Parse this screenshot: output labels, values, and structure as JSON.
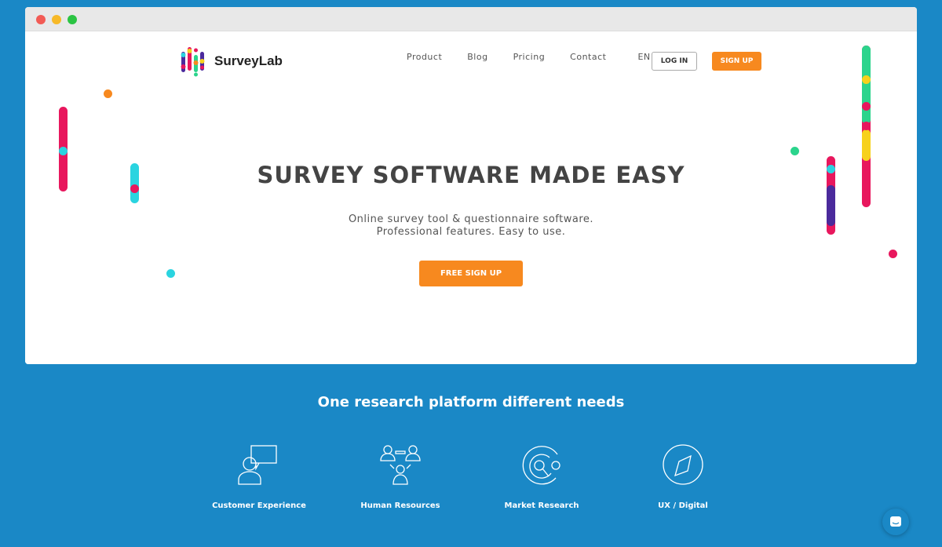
{
  "brand": {
    "name": "SurveyLab"
  },
  "nav": {
    "items": [
      "Product",
      "Blog",
      "Pricing",
      "Contact"
    ],
    "language": "EN",
    "login": "LOG IN",
    "signup": "SIGN UP"
  },
  "hero": {
    "title": "SURVEY SOFTWARE MADE EASY",
    "subtitle_line1": "Online survey tool & questionnaire software.",
    "subtitle_line2": "Professional features. Easy to use.",
    "cta": "FREE SIGN UP"
  },
  "features": {
    "title": "One research platform different needs",
    "items": [
      {
        "label": "Customer Experience",
        "icon": "chat-person-icon"
      },
      {
        "label": "Human Resources",
        "icon": "team-icon"
      },
      {
        "label": "Market Research",
        "icon": "target-icon"
      },
      {
        "label": "UX / Digital",
        "icon": "compass-icon"
      }
    ]
  },
  "colors": {
    "accent": "#f7891f",
    "background": "#1a88c6"
  }
}
